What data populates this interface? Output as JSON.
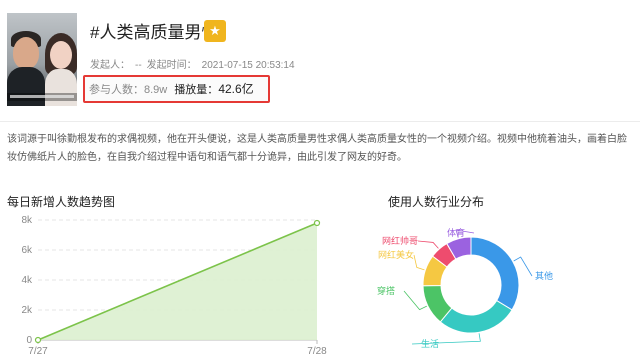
{
  "topic": {
    "title": "#人类高质量男性",
    "badge_icon": "star-hot-icon",
    "initiator_label": "发起人：",
    "initiator_value": "--",
    "time_label": "发起时间：",
    "time_value": "2021-07-15 20:53:14",
    "participants_label": "参与人数：",
    "participants_value": "8.9w",
    "plays_label": "播放量：",
    "plays_value": "42.6亿",
    "description": "该词源于叫徐勤根发布的求偶视频，他在开头便说，这是人类高质量男性求偶人类高质量女性的一个视频介绍。视频中他梳着油头，画着白脸妆仿佛纸片人的脸色，在自我介绍过程中语句和语气都十分诡异，由此引发了网友的好奇。"
  },
  "colors": {
    "accent_red": "#e53935",
    "badge_yellow": "#f0b51e",
    "line_green": "#7cc34a",
    "area_green": "#dcefcf"
  },
  "trend": {
    "title": "每日新增人数趋势图"
  },
  "industry": {
    "title": "使用人数行业分布"
  },
  "chart_data": [
    {
      "type": "area",
      "title": "每日新增人数趋势图",
      "x": [
        "7/27",
        "7/28"
      ],
      "y": [
        0,
        7800
      ],
      "ylim": [
        0,
        8000
      ],
      "yticks": [
        0,
        2000,
        4000,
        6000,
        8000
      ],
      "ytick_labels": [
        "0",
        "2k",
        "4k",
        "6k",
        "8k"
      ],
      "grid": true,
      "color": "#7cc34a"
    },
    {
      "type": "pie",
      "title": "使用人数行业分布",
      "donut": true,
      "slices": [
        {
          "label": "其他",
          "value": 32,
          "color": "#3a98e8"
        },
        {
          "label": "生活",
          "value": 26,
          "color": "#36c9c2"
        },
        {
          "label": "穿搭",
          "value": 13,
          "color": "#4cc466"
        },
        {
          "label": "网红美女",
          "value": 10,
          "color": "#f5c842"
        },
        {
          "label": "网红帅哥",
          "value": 6,
          "color": "#ee4c6e"
        },
        {
          "label": "体育",
          "value": 8,
          "color": "#9b62e0"
        }
      ]
    }
  ]
}
